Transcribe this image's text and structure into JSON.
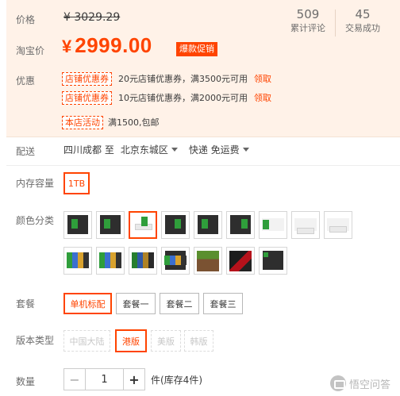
{
  "price": {
    "label": "价格",
    "original": "¥ 3029.29",
    "promo_label": "淘宝价",
    "promo_currency": "¥",
    "promo_value": "2999.00",
    "hot_tag": "爆款促销"
  },
  "stats": {
    "reviews_count": "509",
    "reviews_label": "累计评论",
    "deals_count": "45",
    "deals_label": "交易成功"
  },
  "promotions": {
    "label": "优惠",
    "coupons": [
      {
        "tag": "店铺优惠券",
        "text": "20元店铺优惠券，满3500元可用",
        "action": "领取"
      },
      {
        "tag": "店铺优惠券",
        "text": "10元店铺优惠券，满2000元可用",
        "action": "领取"
      }
    ],
    "event_tag": "本店活动",
    "event_text": "满1500,包邮"
  },
  "shipping": {
    "label": "配送",
    "from": "四川成都 至",
    "to": "北京东城区",
    "method": "快递 免运费"
  },
  "storage": {
    "label": "内存容量",
    "options": [
      "1TB"
    ],
    "selected": "1TB"
  },
  "color": {
    "label": "颜色分类",
    "selected_index": 2,
    "swatch_count": 16
  },
  "bundle": {
    "label": "套餐",
    "options": [
      "单机标配",
      "套餐一",
      "套餐二",
      "套餐三"
    ],
    "selected": "单机标配"
  },
  "version": {
    "label": "版本类型",
    "options": [
      "中国大陆",
      "港版",
      "美版",
      "韩版"
    ],
    "selected": "港版",
    "disabled": [
      "中国大陆",
      "美版",
      "韩版"
    ]
  },
  "quantity": {
    "label": "数量",
    "minus": "−",
    "value": "1",
    "plus": "+",
    "stock_text": "件(库存4件)"
  },
  "watermark": {
    "text": "悟空问答"
  },
  "colors": {
    "accent": "#ff4400",
    "panel_bg": "#fff2e8"
  }
}
